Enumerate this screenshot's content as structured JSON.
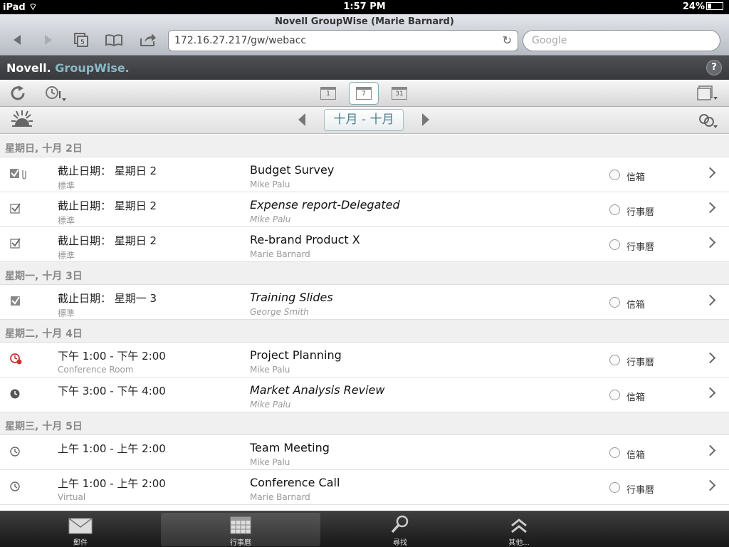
{
  "status": {
    "device": "iPad",
    "time": "1:57 PM",
    "battery": "24%"
  },
  "browser": {
    "title": "Novell GroupWise (Marie Barnard)",
    "url": "172.16.27.217/gw/webacc",
    "search_placeholder": "Google"
  },
  "app": {
    "brand_novell": "Novell.",
    "brand_gw": "GroupWise.",
    "help": "?"
  },
  "toolbar": {
    "day_num": "1",
    "week_num": "7",
    "month_num": "31"
  },
  "datebar": {
    "range": "十月 - 十月"
  },
  "groups": [
    {
      "header": "星期日, 十月 2日",
      "items": [
        {
          "icon": "task-done-attachment-icon",
          "when": "截止日期： 星期日 2",
          "sub": "標準",
          "subject": "Budget Survey",
          "subject_italic": false,
          "from": "Mike Palu",
          "from_italic": false,
          "place": "信箱"
        },
        {
          "icon": "task-checkbox-icon",
          "when": "截止日期： 星期日 2",
          "sub": "標準",
          "subject": "Expense report-Delegated",
          "subject_italic": true,
          "from": "Mike Palu",
          "from_italic": true,
          "place": "行事曆"
        },
        {
          "icon": "task-checkbox-icon",
          "when": "截止日期： 星期日 2",
          "sub": "標準",
          "subject": "Re-brand Product X",
          "subject_italic": false,
          "from": "Marie Barnard",
          "from_italic": false,
          "place": "行事曆"
        }
      ]
    },
    {
      "header": "星期一, 十月 3日",
      "items": [
        {
          "icon": "task-done-icon",
          "when": "截止日期： 星期一 3",
          "sub": "標準",
          "subject": "Training Slides",
          "subject_italic": true,
          "from": "George Smith",
          "from_italic": true,
          "place": "信箱"
        }
      ]
    },
    {
      "header": "星期二, 十月 4日",
      "items": [
        {
          "icon": "appointment-alert-icon",
          "when": "下午 1:00 - 下午 2:00",
          "sub": "Conference Room",
          "subject": "Project Planning",
          "subject_italic": false,
          "from": "Mike Palu",
          "from_italic": false,
          "place": "行事曆"
        },
        {
          "icon": "appointment-accepted-icon",
          "when": "下午 3:00 - 下午 4:00",
          "sub": "",
          "subject": "Market Analysis Review",
          "subject_italic": true,
          "from": "Mike Palu",
          "from_italic": true,
          "place": "信箱"
        }
      ]
    },
    {
      "header": "星期三, 十月 5日",
      "items": [
        {
          "icon": "appointment-clock-icon",
          "when": "上午 1:00 - 上午 2:00",
          "sub": "",
          "subject": "Team Meeting",
          "subject_italic": false,
          "from": "Mike Palu",
          "from_italic": false,
          "place": "信箱"
        },
        {
          "icon": "appointment-clock-icon",
          "when": "上午 1:00 - 上午 2:00",
          "sub": "Virtual",
          "subject": "Conference Call",
          "subject_italic": false,
          "from": "Marie Barnard",
          "from_italic": false,
          "place": "行事曆"
        }
      ]
    }
  ],
  "tabs": [
    {
      "label": "郵件",
      "icon": "mail-icon"
    },
    {
      "label": "行事曆",
      "icon": "calendar-icon"
    },
    {
      "label": "尋找",
      "icon": "magnifier-icon"
    },
    {
      "label": "其他...",
      "icon": "more-chevrons-icon"
    }
  ]
}
